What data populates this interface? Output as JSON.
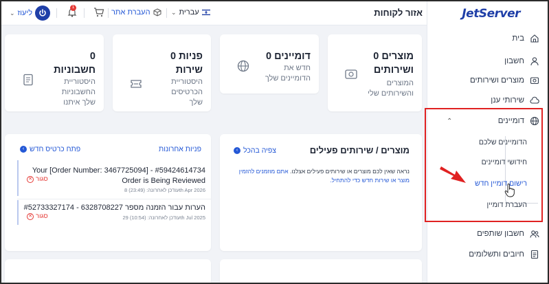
{
  "brand": {
    "logo": "JetServer",
    "accent": "#2458d6",
    "logo_color": "#1f3fa8"
  },
  "topbar": {
    "title": "אזור לקוחות",
    "language": "עברית",
    "transfer": "העברת אתר",
    "notifications_count": "1",
    "user_label": "ליעוז"
  },
  "sidebar": {
    "items": [
      {
        "label": "בית",
        "icon": "home-icon"
      },
      {
        "label": "חשבון",
        "icon": "user-icon"
      },
      {
        "label": "מוצרים ושירותים",
        "icon": "box-icon"
      },
      {
        "label": "שירותי ענן",
        "icon": "cloud-icon"
      },
      {
        "label": "דומיינים",
        "icon": "globe-icon"
      },
      {
        "label": "חשבון שותפים",
        "icon": "partners-icon"
      },
      {
        "label": "חיובים ותשלומים",
        "icon": "invoice-icon"
      }
    ],
    "domains_submenu": [
      {
        "label": "הדומיינים שלכם"
      },
      {
        "label": "חידושי דומיינים"
      },
      {
        "label": "רישום דומיין חדש"
      },
      {
        "label": "העברת דומיין"
      }
    ]
  },
  "stats": [
    {
      "title_line1": "0 מוצרים",
      "title_line2": "ושירותים",
      "desc_line1": "המוצרים",
      "desc_line2": "והשירותים שלי",
      "icon": "product-icon"
    },
    {
      "title_line1": "0 דומיינים",
      "title_line2": "",
      "desc_line1": "חדש את",
      "desc_line2": "הדומיינים שלך",
      "icon": "globe-icon"
    },
    {
      "title_line1": "0 פניות",
      "title_line2": "שירות",
      "desc_line1": "היסטוריית",
      "desc_line2": "הכרטיסים",
      "desc_line3": "שלך",
      "icon": "ticket-icon"
    },
    {
      "title_line1": "0",
      "title_line2": "חשבוניות",
      "desc_line1": "היסטוריית",
      "desc_line2": "החשבוניות",
      "desc_line3": "שלך איתנו",
      "icon": "invoice-icon"
    }
  ],
  "products_panel": {
    "title": "מוצרים / שירותים פעילים",
    "link": "צפיה בהכל",
    "text": "נראה שאין לכם מוצרים או שירותים פעילים אצלנו.",
    "text_link": "אתם מוזמנים להזמין מוצר או שירות חדש כדי להתחיל."
  },
  "tickets_panel": {
    "title": "פניות אחרונות",
    "link": "פתח כרטיס חדש",
    "tickets": [
      {
        "line1": "Your [Order Number: 3467725094] - #59424614734",
        "line2": "Order is Being Reviewed",
        "date": "עודכן לאחרונה: (23:49) 8th Apr 2026",
        "status": "סגור"
      },
      {
        "line1": "#52733327174 - הערות עבור הזמנה מספר 6328708227",
        "line2": "",
        "date": "עודכן לאחרונה: (10:54) 29th Jul 2025",
        "status": "סגור"
      }
    ]
  }
}
